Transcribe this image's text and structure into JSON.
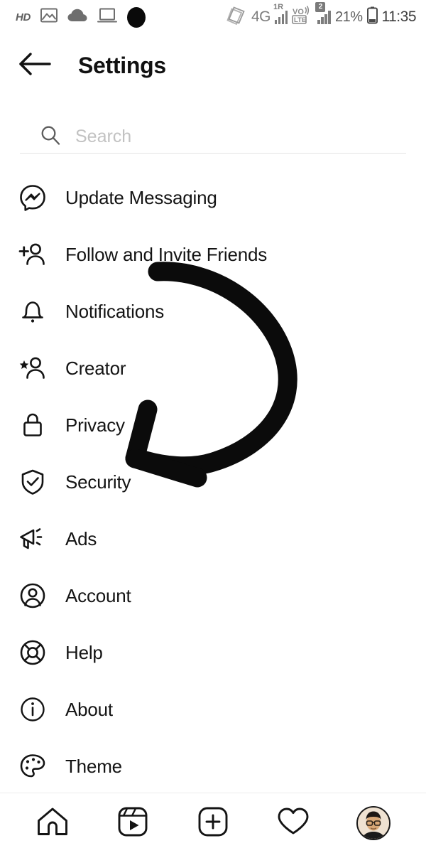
{
  "status_bar": {
    "hd_label": "HD",
    "left_icons": [
      "hd-label",
      "image-icon",
      "cloud-icon",
      "laptop-icon",
      "black-dot-icon"
    ],
    "right_icons": [
      "rotating-cards-icon",
      "signal-bars-icon",
      "volte-icon",
      "sim2-signal-icon",
      "battery-icon"
    ],
    "network_type": "4G",
    "roaming_label": "1R",
    "volte_label_top": "VO",
    "volte_label_bottom": "LTE",
    "sim_badge": "2",
    "battery_percent": "21%",
    "clock": "11:35"
  },
  "header": {
    "title": "Settings",
    "back_icon": "arrow-left-icon"
  },
  "search": {
    "placeholder": "Search",
    "value": "",
    "icon": "search-icon"
  },
  "menu": {
    "items": [
      {
        "label": "Update Messaging",
        "icon": "messenger-icon"
      },
      {
        "label": "Follow and Invite Friends",
        "icon": "person-add-icon"
      },
      {
        "label": "Notifications",
        "icon": "bell-icon"
      },
      {
        "label": "Creator",
        "icon": "person-star-icon"
      },
      {
        "label": "Privacy",
        "icon": "lock-icon"
      },
      {
        "label": "Security",
        "icon": "shield-check-icon"
      },
      {
        "label": "Ads",
        "icon": "megaphone-icon"
      },
      {
        "label": "Account",
        "icon": "account-circle-icon"
      },
      {
        "label": "Help",
        "icon": "life-ring-icon"
      },
      {
        "label": "About",
        "icon": "info-circle-icon"
      },
      {
        "label": "Theme",
        "icon": "palette-icon"
      }
    ]
  },
  "annotation": {
    "type": "hand-drawn-curved-arrow",
    "color": "#0b0b0b",
    "points_at": "Security",
    "stroke_width": 26
  },
  "bottom_nav": {
    "items": [
      {
        "name": "home",
        "icon": "home-icon"
      },
      {
        "name": "reels",
        "icon": "reels-icon"
      },
      {
        "name": "create",
        "icon": "plus-square-icon"
      },
      {
        "name": "activity",
        "icon": "heart-icon"
      },
      {
        "name": "profile",
        "icon": "avatar-icon"
      }
    ]
  },
  "colors": {
    "background": "#ffffff",
    "text": "#141414",
    "muted": "#c2c2c2",
    "divider": "#ececec",
    "annotation": "#0b0b0b"
  }
}
